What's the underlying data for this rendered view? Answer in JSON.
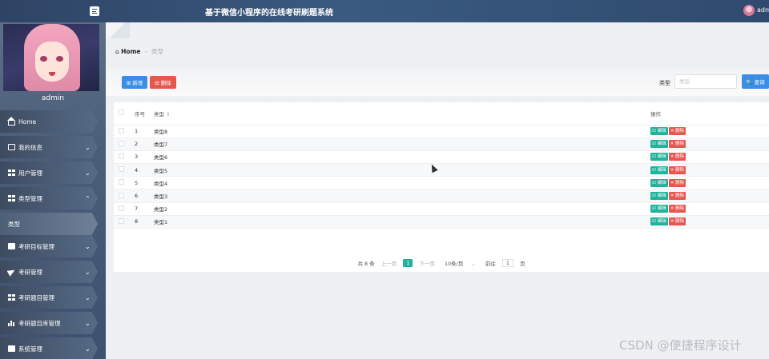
{
  "header": {
    "app_title": "基于微信小程序的在线考研刷题系统",
    "user_name": "adm"
  },
  "sidebar": {
    "user_name": "admin",
    "items": [
      {
        "label": "Home",
        "icon": "home-icon"
      },
      {
        "label": "我的信息",
        "icon": "card-icon"
      },
      {
        "label": "用户管理",
        "icon": "grid-icon"
      },
      {
        "label": "类型管理",
        "icon": "grid-icon"
      },
      {
        "label": "类型",
        "icon": "chevron-right-icon"
      },
      {
        "label": "考研目标管理",
        "icon": "chat-icon"
      },
      {
        "label": "考研管理",
        "icon": "send-icon"
      },
      {
        "label": "考研题目管理",
        "icon": "grid-icon"
      },
      {
        "label": "考研题目库管理",
        "icon": "bar-chart-icon"
      },
      {
        "label": "系统管理",
        "icon": "briefcase-icon"
      }
    ]
  },
  "breadcrumb": {
    "home": "Home",
    "separator": "-",
    "current": "类型"
  },
  "toolbar": {
    "add_label": "⊞ 新增",
    "delete_label": "⊟ 删除",
    "search_label": "类型",
    "search_placeholder": "类型",
    "search_button": "🔍 查询"
  },
  "table": {
    "headers": {
      "index": "序号",
      "type": "类型",
      "ops": "操作"
    },
    "edit_label": "☑ 编辑",
    "delete_label": "✕ 删除",
    "rows": [
      {
        "index": "1",
        "type": "类型8"
      },
      {
        "index": "2",
        "type": "类型7"
      },
      {
        "index": "3",
        "type": "类型6"
      },
      {
        "index": "4",
        "type": "类型5"
      },
      {
        "index": "5",
        "type": "类型4"
      },
      {
        "index": "6",
        "type": "类型3"
      },
      {
        "index": "7",
        "type": "类型2"
      },
      {
        "index": "8",
        "type": "类型1"
      }
    ]
  },
  "pagination": {
    "total": "共 8 条",
    "prev": "上一页",
    "current": "1",
    "next": "下一页",
    "page_size": "10条/页",
    "goto_label": "前往",
    "goto_value": "1",
    "page_suffix": "页"
  },
  "watermark": "CSDN @便捷程序设计",
  "colors": {
    "topbar": "#2e4465",
    "primary": "#3a8ee6",
    "danger": "#e8574f",
    "success": "#1fb39b"
  }
}
